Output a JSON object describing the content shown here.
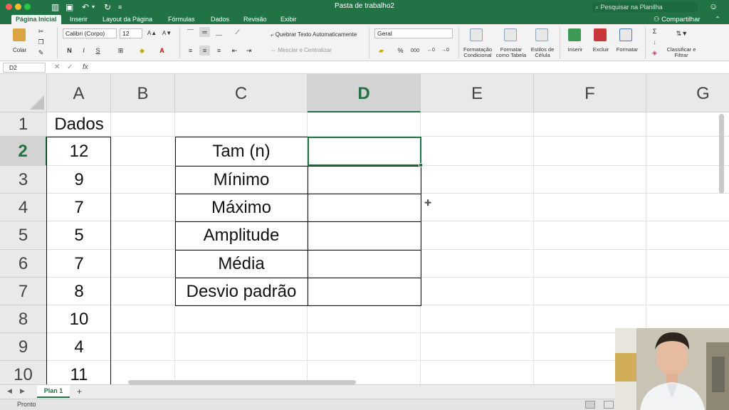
{
  "window": {
    "title": "Pasta de trabalho2",
    "search_placeholder": "Pesquisar na Planilha",
    "share_label": "Compartilhar"
  },
  "tabs": [
    {
      "label": "Página Inicial",
      "active": true
    },
    {
      "label": "Inserir"
    },
    {
      "label": "Layout da Página"
    },
    {
      "label": "Fórmulas"
    },
    {
      "label": "Dados"
    },
    {
      "label": "Revisão"
    },
    {
      "label": "Exibir"
    }
  ],
  "ribbon": {
    "paste_label": "Colar",
    "font_name": "Calibri (Corpo)",
    "font_size": "12",
    "bold": "N",
    "italic": "I",
    "underline": "S",
    "wrap_text": "Quebrar Texto Automaticamente",
    "merge_center": "Mesclar e Centralizar",
    "number_format": "Geral",
    "percent": "%",
    "thousands": "000",
    "cond_format": "Formatação Condicional",
    "format_table": "Formatar como Tabela",
    "cell_styles": "Estilos de Célula",
    "insert": "Inserir",
    "delete": "Excluir",
    "format": "Formatar",
    "sort_filter": "Classificar e Filtrar",
    "accent_color": "#217346"
  },
  "formula_bar": {
    "name_box": "D2",
    "fx": "fx",
    "value": ""
  },
  "grid": {
    "columns": [
      "A",
      "B",
      "C",
      "D",
      "E",
      "F",
      "G"
    ],
    "selected_column": "D",
    "rows": [
      "1",
      "2",
      "3",
      "4",
      "5",
      "6",
      "7",
      "8",
      "9",
      "10"
    ],
    "selected_row": "2",
    "selected_cell": "D2",
    "header_a1": "Dados",
    "col_a_values": [
      "12",
      "9",
      "7",
      "5",
      "7",
      "8",
      "10",
      "4",
      "11"
    ],
    "stats_labels": [
      "Tam (n)",
      "Mínimo",
      "Máximo",
      "Amplitude",
      "Média",
      "Desvio padrão"
    ]
  },
  "sheets": [
    {
      "label": "Plan 1",
      "active": true
    }
  ],
  "add_sheet": "+",
  "status": {
    "text": "Pronto"
  }
}
